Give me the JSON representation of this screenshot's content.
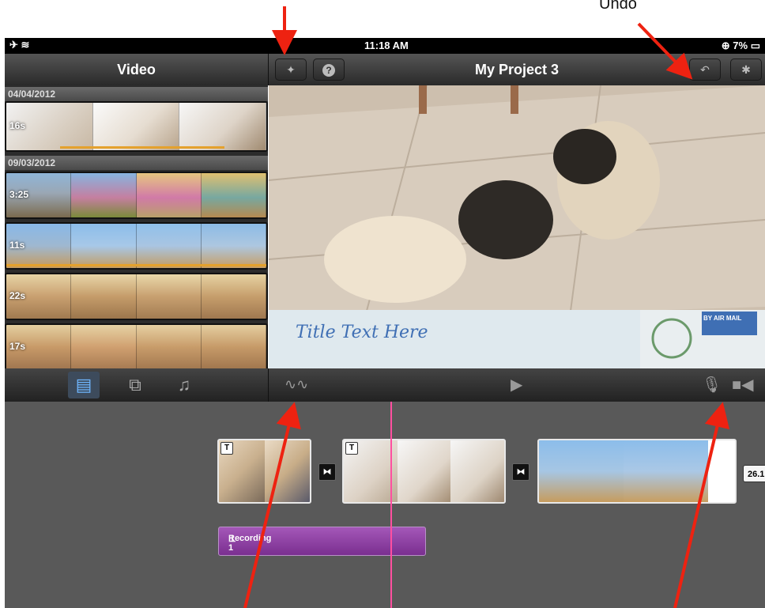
{
  "annotation": {
    "undo_label": "Undo"
  },
  "status_bar": {
    "time": "11:18 AM",
    "battery": "7%"
  },
  "media_browser": {
    "title": "Video",
    "help_label": "?",
    "groups": [
      {
        "date": "04/04/2012",
        "clips": [
          {
            "duration": "16s"
          }
        ]
      },
      {
        "date": "09/03/2012",
        "clips": [
          {
            "duration": "3:25"
          },
          {
            "duration": "11s"
          },
          {
            "duration": "22s"
          },
          {
            "duration": "17s"
          }
        ]
      }
    ],
    "tabs": [
      "video-tab",
      "photos-tab",
      "audio-tab"
    ]
  },
  "project": {
    "title": "My Project 3",
    "viewer_title_text": "Title Text Here",
    "airmail_text": "BY AIR MAIL"
  },
  "timeline": {
    "clips": [
      {
        "badge": "T"
      },
      {
        "badge": "T"
      },
      {
        "badge": ""
      }
    ],
    "recording_label": "Recording 1",
    "duration_label": "26.1"
  },
  "colors": {
    "accent": "#e4a12d",
    "playhead": "#ff4fa0",
    "recording": "#8e3fa6",
    "arrow": "#ee2211"
  }
}
